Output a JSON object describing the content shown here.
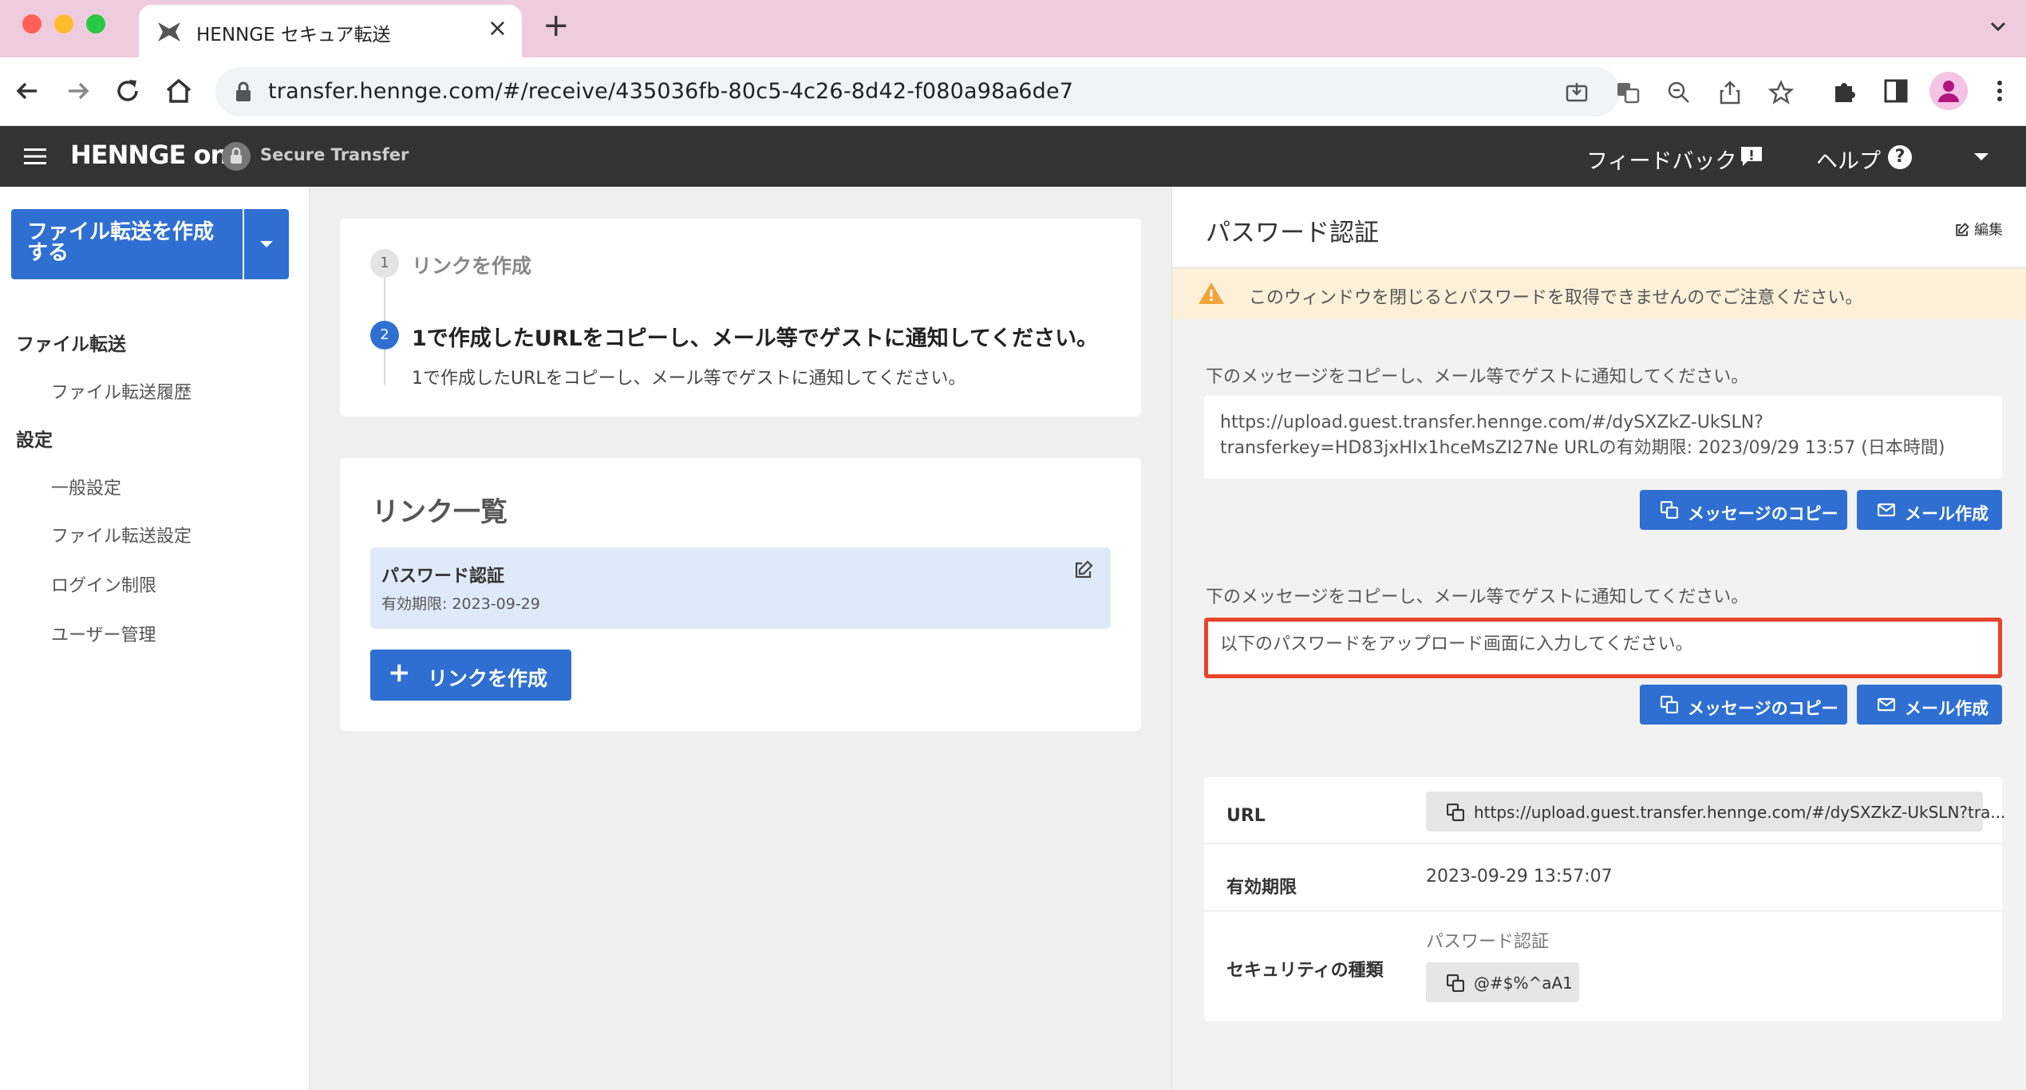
{
  "browser": {
    "tab_title": "HENNGE セキュア転送",
    "tab_close": "×",
    "new_tab": "+",
    "url": "transfer.hennge.com/#/receive/435036fb-80c5-4c26-8d42-f080a98a6de7",
    "icons": [
      "back-arrow-icon",
      "forward-arrow-icon",
      "reload-icon",
      "home-icon",
      "lock-icon",
      "install-icon",
      "translate-icon",
      "zoom-icon",
      "share-icon",
      "star-icon",
      "extensions-icon",
      "side-panel-icon",
      "profile-icon",
      "kebab-menu-icon"
    ]
  },
  "header": {
    "brand": "HENNGE one",
    "product": "Secure Transfer",
    "feedback": "フィードバック",
    "help": "ヘルプ",
    "help_glyph": "?"
  },
  "sidebar": {
    "create_button": "ファイル転送を作成する",
    "sections": [
      {
        "title": "ファイル転送",
        "items": [
          "ファイル転送履歴"
        ]
      },
      {
        "title": "設定",
        "items": [
          "一般設定",
          "ファイル転送設定",
          "ログイン制限",
          "ユーザー管理"
        ]
      }
    ]
  },
  "steps": {
    "step1_number": "1",
    "step1_label": "リンクを作成",
    "step2_number": "2",
    "step2_title": "1で作成したURLをコピーし、メール等でゲストに通知してください。",
    "step2_desc": "1で作成したURLをコピーし、メール等でゲストに通知してください。"
  },
  "links": {
    "title": "リンク一覧",
    "item_title": "パスワード認証",
    "item_expiry": "有効期限: 2023-09-29",
    "add_button_plus": "+",
    "add_button": "リンクを作成"
  },
  "panel": {
    "title": "パスワード認証",
    "edit": "編集",
    "warning": "このウィンドウを閉じるとパスワードを取得できませんのでご注意ください。",
    "msg1_label": "下のメッセージをコピーし、メール等でゲストに通知してください。",
    "msg1_line1": "https://upload.guest.transfer.hennge.com/#/dySXZkZ-UkSLN?",
    "msg1_line2": "transferkey=HD83jxHIx1hceMsZI27Ne URLの有効期限: 2023/09/29 13:57 (日本時間)",
    "msg2_label": "下のメッセージをコピーし、メール等でゲストに通知してください。",
    "msg2_text": "以下のパスワードをアップロード画面に入力してください。",
    "copy_button": "メッセージのコピー",
    "mail_button": "メール作成",
    "info": {
      "url_key": "URL",
      "url_value": "https://upload.guest.transfer.hennge.com/#/dySXZkZ-UkSLN?tra...",
      "expiry_key": "有効期限",
      "expiry_value": "2023-09-29 13:57:07",
      "security_key": "セキュリティの種類",
      "security_type": "パスワード認証",
      "password": "@#$%^aA1"
    }
  },
  "colors": {
    "primary": "#2f6fd1",
    "header_bg": "#333333",
    "warning_bg": "#fcf1d8",
    "highlight": "#e8442c",
    "tab_strip": "#eeccdd"
  }
}
